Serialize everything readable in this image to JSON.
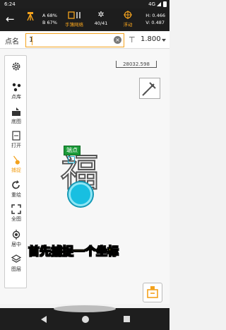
{
  "status_bar": {
    "time": "6:24",
    "network": "4G"
  },
  "header": {
    "back_icon": "arrow-left-icon",
    "satellite": {
      "a_pct": "A 68%",
      "b_pct": "B 67%"
    },
    "correction": {
      "label": "手簿网络",
      "icon": "antenna-icon"
    },
    "sats": {
      "label": "40/41",
      "icon": "satellite-icon"
    },
    "solution": {
      "label": "浮动",
      "icon": "crosshair-icon"
    },
    "precision": {
      "h": "H: 0.466",
      "v": "V: 0.487"
    }
  },
  "point_row": {
    "label": "点名",
    "value": "1",
    "antenna_height": "1.800"
  },
  "toolbar": {
    "items": [
      {
        "icon": "gear-icon",
        "label": ""
      },
      {
        "icon": "points-icon",
        "label": "点库"
      },
      {
        "icon": "layers-map-icon",
        "label": "底图"
      },
      {
        "icon": "dxf-file-icon",
        "label": "打开"
      },
      {
        "icon": "snap-icon",
        "label": "捕捉"
      },
      {
        "icon": "redo-icon",
        "label": "重绘"
      },
      {
        "icon": "fullscreen-icon",
        "label": "全图"
      },
      {
        "icon": "center-icon",
        "label": "居中"
      },
      {
        "icon": "layers-icon",
        "label": "图层"
      }
    ]
  },
  "map": {
    "scale": "28032.598",
    "endpoint_tag": "端点",
    "caption": "首先捕捉一个坐标"
  },
  "colors": {
    "accent": "#f3a21d",
    "gps": "#18bfe1",
    "tag": "#1a9a38",
    "caption": "#fbe40e"
  }
}
